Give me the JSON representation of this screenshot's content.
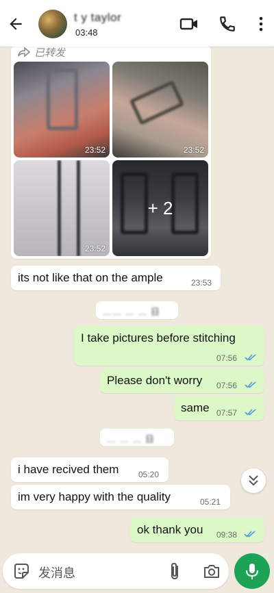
{
  "header": {
    "contact_name": "t  y taylor",
    "last_seen": "03:48"
  },
  "forwarded_card": {
    "forwarded_label": "已转发",
    "thumbnails": [
      {
        "time": "23:52"
      },
      {
        "time": "23:52"
      },
      {
        "time": "23:52"
      },
      {
        "more_count": "+ 2"
      }
    ]
  },
  "messages": [
    {
      "direction": "in",
      "text": "its not like that on the ample",
      "time": "23:53"
    },
    {
      "direction": "out",
      "text": "I take pictures before stitching",
      "time": "07:56",
      "read": true
    },
    {
      "direction": "out",
      "text": "Please don't worry",
      "time": "07:56",
      "read": true
    },
    {
      "direction": "out",
      "text": "same",
      "time": "07:57",
      "read": true
    },
    {
      "direction": "in",
      "text": "i have recived them",
      "time": "05:20"
    },
    {
      "direction": "in",
      "text": "im very happy with the quality",
      "time": "05:21"
    },
    {
      "direction": "out",
      "text": "ok thank you",
      "time": "09:38",
      "read": true
    }
  ],
  "date_chips": [
    "…… … … 日",
    "… … … 日"
  ],
  "input": {
    "placeholder": "发消息"
  },
  "icons": {
    "back": "arrow-left-icon",
    "video": "video-camera-icon",
    "call": "phone-icon",
    "more": "more-vertical-icon",
    "sticker": "sticker-icon",
    "attach": "paperclip-icon",
    "camera": "camera-icon",
    "mic": "microphone-icon",
    "scroll": "double-chevron-down-icon"
  },
  "colors": {
    "header_bg": "#ffffff",
    "chat_bg": "#efe8dc",
    "incoming_bubble": "#ffffff",
    "outgoing_bubble": "#dbf8c6",
    "read_ticks": "#4a9be8",
    "mic_button": "#1da356"
  }
}
